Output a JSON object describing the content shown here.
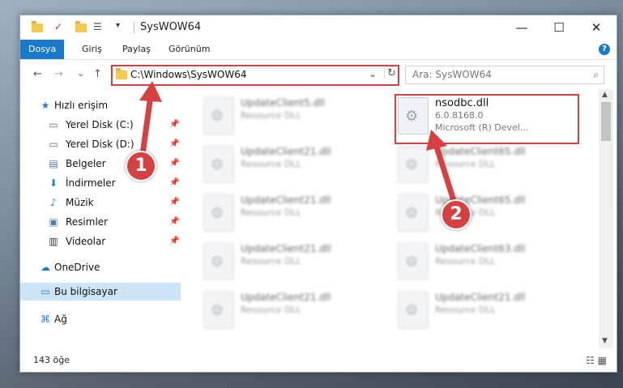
{
  "window": {
    "title": "SysWOW64"
  },
  "ribbon": {
    "tabs": [
      "Dosya",
      "Giriş",
      "Paylaş",
      "Görünüm"
    ],
    "help": "?"
  },
  "window_controls": {
    "minimize": "—",
    "maximize": "☐",
    "close": "✕"
  },
  "nav": {
    "back": "←",
    "forward": "→",
    "recent": "⌄",
    "up": "↑",
    "refresh": "↻",
    "dropdown": "⌄"
  },
  "address": {
    "path": "C:\\Windows\\SysWOW64"
  },
  "search": {
    "placeholder": "Ara: SysWOW64",
    "icon": "search-icon"
  },
  "sidebar": {
    "items": [
      {
        "label": "Hızlı erişim",
        "icon": "star-icon"
      },
      {
        "label": "Yerel Disk (C:)",
        "icon": "drive-icon"
      },
      {
        "label": "Yerel Disk (D:)",
        "icon": "drive-icon"
      },
      {
        "label": "Belgeler",
        "icon": "documents-icon"
      },
      {
        "label": "İndirmeler",
        "icon": "download-icon"
      },
      {
        "label": "Müzik",
        "icon": "music-icon"
      },
      {
        "label": "Resimler",
        "icon": "pictures-icon"
      },
      {
        "label": "Videolar",
        "icon": "video-icon"
      },
      {
        "label": "OneDrive",
        "icon": "cloud-icon"
      },
      {
        "label": "Bu bilgisayar",
        "icon": "computer-icon"
      },
      {
        "label": "Ağ",
        "icon": "network-icon"
      }
    ]
  },
  "files": {
    "left": [
      {
        "name": "UpdateClient5.dll",
        "type": "Resource DLL"
      },
      {
        "name": "UpdateClient21.dll",
        "type": "Resource DLL"
      },
      {
        "name": "UpdateClient21.dll",
        "type": "Resource DLL"
      },
      {
        "name": "UpdateClient21.dll",
        "type": "Resource DLL"
      },
      {
        "name": "UpdateClient21.dll",
        "type": "Resource DLL"
      }
    ],
    "right": [
      {
        "name": "UpdateClient65.dll",
        "type": "Resource DLL"
      },
      {
        "name": "UpdateClient65.dll",
        "type": "Resource DLL"
      },
      {
        "name": "UpdateClient63.dll",
        "type": "Resource DLL"
      },
      {
        "name": "UpdateClient21.dll",
        "type": "Resource DLL"
      }
    ],
    "highlighted": {
      "name": "nsodbc.dll",
      "version": "6.0.8168.0",
      "company": "Microsoft (R) Devel..."
    }
  },
  "status": {
    "count": "143 öğe"
  },
  "callouts": {
    "first": "1",
    "second": "2"
  },
  "colors": {
    "accent": "#1979ca",
    "callout": "#d64040"
  }
}
